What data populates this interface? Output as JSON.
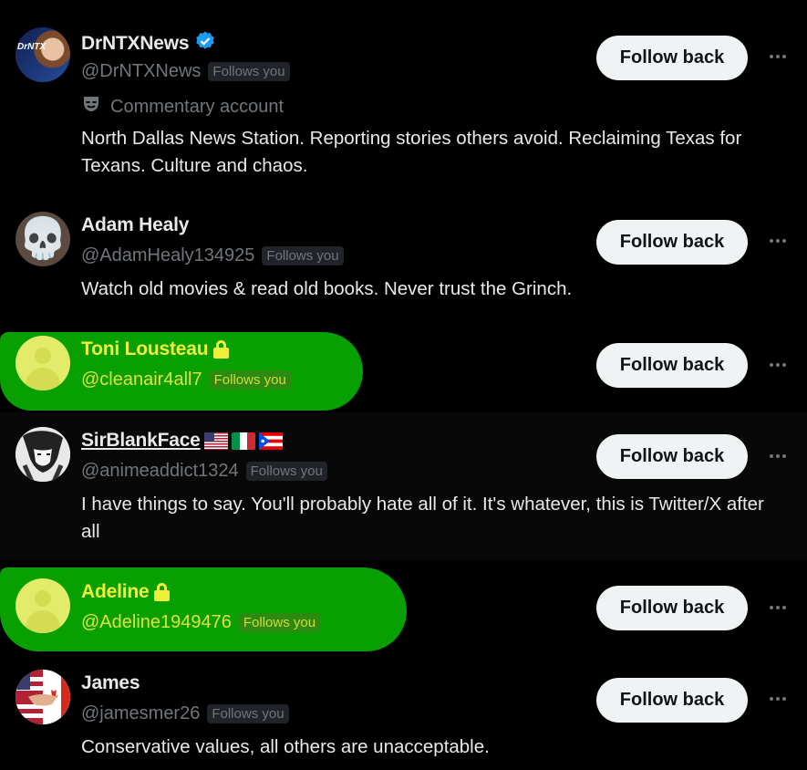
{
  "users": [
    {
      "name": "DrNTXNews",
      "handle": "@DrNTXNews",
      "follows_you": "Follows you",
      "label": "Commentary account",
      "bio": "North Dallas News Station. Reporting stories others avoid. Reclaiming Texas for Texans. Culture and chaos.",
      "button": "Follow back",
      "avatar_text": "DrNTX"
    },
    {
      "name": "Adam Healy",
      "handle": "@AdamHealy134925",
      "follows_you": "Follows you",
      "bio": "Watch old movies & read old books. Never trust the Grinch.",
      "button": "Follow back",
      "avatar_emoji": "💀"
    },
    {
      "name": "Toni Lousteau",
      "handle": "@cleanair4all7",
      "follows_you": "Follows you",
      "button": "Follow back"
    },
    {
      "name": "SirBlankFace",
      "handle": "@animeaddict1324",
      "follows_you": "Follows you",
      "bio": "I have things to say. You'll probably hate all of it. It's whatever, this is Twitter/X after all",
      "button": "Follow back"
    },
    {
      "name": "Adeline",
      "handle": "@Adeline1949476",
      "follows_you": "Follows you",
      "button": "Follow back"
    },
    {
      "name": "James",
      "handle": "@jamesmer26",
      "follows_you": "Follows you",
      "bio": "Conservative values, all others are unacceptable.",
      "button": "Follow back"
    }
  ],
  "colors": {
    "background": "#000000",
    "highlight": "#07a000",
    "verified": "#1d9bf0",
    "button_bg": "#eff3f4"
  }
}
